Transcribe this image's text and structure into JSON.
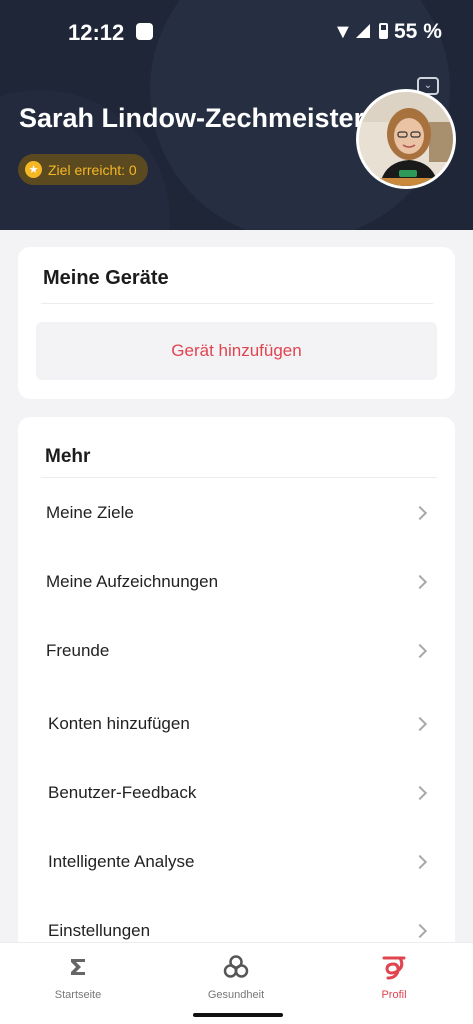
{
  "status_bar": {
    "time": "12:12",
    "battery": "55 %"
  },
  "profile": {
    "name": "Sarah Lindow-Zechmeister",
    "goal_badge": "Ziel erreicht: 0"
  },
  "devices_card": {
    "title": "Meine Geräte",
    "add_device_label": "Gerät hinzufügen"
  },
  "more_card": {
    "title": "Mehr",
    "items": [
      {
        "label": "Meine Ziele"
      },
      {
        "label": "Meine Aufzeichnungen"
      },
      {
        "label": "Freunde"
      },
      {
        "label": "Konten hinzufügen"
      },
      {
        "label": "Benutzer-Feedback"
      },
      {
        "label": "Intelligente Analyse"
      },
      {
        "label": "Einstellungen"
      }
    ]
  },
  "bottom_nav": {
    "items": [
      {
        "label": "Startseite",
        "icon": "sigma-icon"
      },
      {
        "label": "Gesundheit",
        "icon": "health-icon"
      },
      {
        "label": "Profil",
        "icon": "profile-icon"
      }
    ],
    "active": "Profil"
  },
  "colors": {
    "accent": "#e0444f",
    "header_bg": "#1f2638",
    "goal_gold": "#f5b724"
  }
}
